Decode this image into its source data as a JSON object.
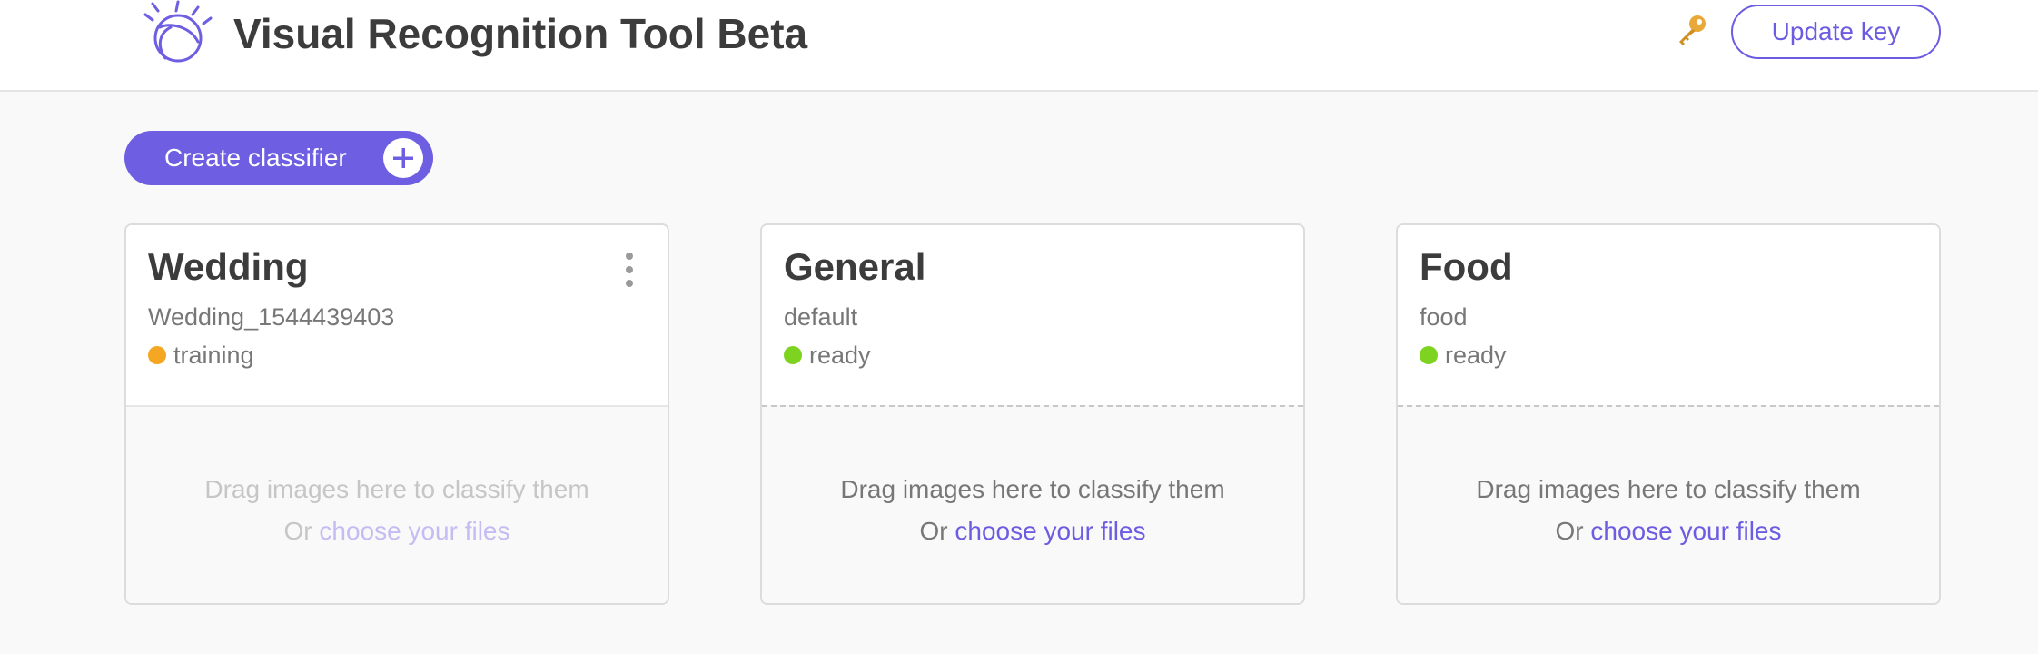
{
  "header": {
    "title": "Visual Recognition Tool Beta",
    "update_key_label": "Update key",
    "key_icon": "key-icon",
    "logo_icon": "ibm-watson-logo"
  },
  "toolbar": {
    "create_label": "Create classifier",
    "create_icon": "plus-icon"
  },
  "colors": {
    "accent": "#6c5ce2",
    "training": "#f5a623",
    "ready": "#7ed321"
  },
  "classifiers": [
    {
      "name": "Wedding",
      "id": "Wedding_1544439403",
      "status": "training",
      "drop_text": "Drag images here to classify them",
      "drop_or": "Or ",
      "drop_link": "choose your files"
    },
    {
      "name": "General",
      "id": "default",
      "status": "ready",
      "drop_text": "Drag images here to classify them",
      "drop_or": "Or ",
      "drop_link": "choose your files"
    },
    {
      "name": "Food",
      "id": "food",
      "status": "ready",
      "drop_text": "Drag images here to classify them",
      "drop_or": "Or ",
      "drop_link": "choose your files"
    }
  ]
}
